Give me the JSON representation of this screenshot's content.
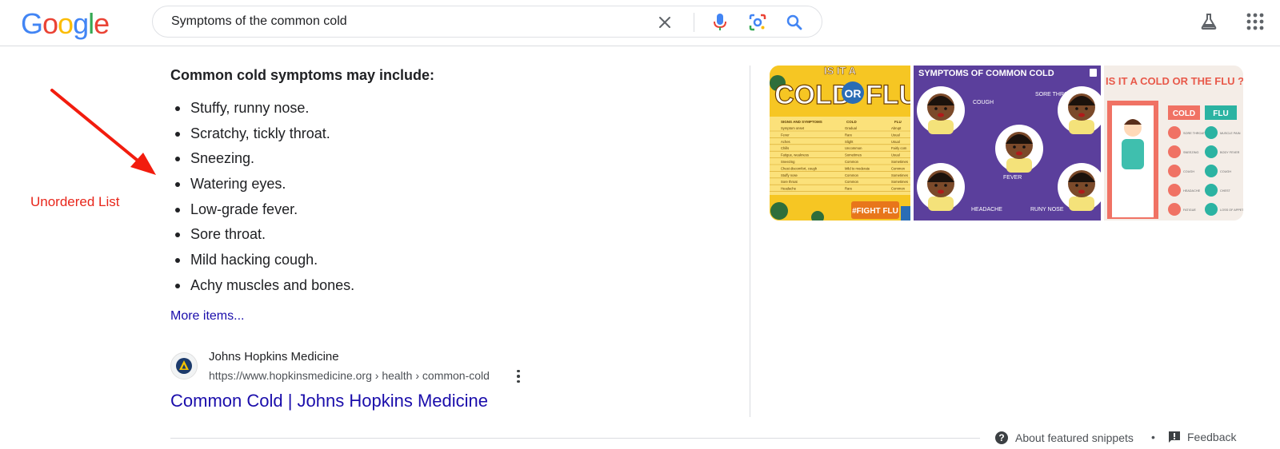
{
  "search": {
    "query": "Symptoms of the common cold"
  },
  "logo": {
    "letters": [
      "G",
      "o",
      "o",
      "g",
      "l",
      "e"
    ],
    "colors": [
      "#4285F4",
      "#EA4335",
      "#FBBC05",
      "#4285F4",
      "#34A853",
      "#EA4335"
    ]
  },
  "annotation": {
    "label": "Unordered List",
    "color": "#e8261b"
  },
  "snippet": {
    "heading": "Common cold symptoms may include:",
    "items": [
      "Stuffy, runny nose.",
      "Scratchy, tickly throat.",
      "Sneezing.",
      "Watering eyes.",
      "Low-grade fever.",
      "Sore throat.",
      "Mild hacking cough.",
      "Achy muscles and bones."
    ],
    "more_items": "More items..."
  },
  "source": {
    "name": "Johns Hopkins Medicine",
    "url": "https://www.hopkinsmedicine.org › health › common-cold",
    "title": "Common Cold | Johns Hopkins Medicine"
  },
  "images": {
    "img1": {
      "top_text": "IS IT A",
      "big_text_a": "COLD",
      "big_text_or": "OR",
      "big_text_b": "FLU",
      "col1": "SIGNS AND SYMPTOMS",
      "col2": "COLD",
      "col3": "FLU",
      "rows": [
        "Symptom onset",
        "Fever",
        "Aches",
        "Chills",
        "Fatigue, weakness",
        "Sneezing",
        "Chest discomfort, cough",
        "Stuffy nose",
        "Sore throat",
        "Headache"
      ],
      "cold_vals": [
        "Gradual",
        "Rare",
        "Slight",
        "Uncommon",
        "Sometimes",
        "Common",
        "Mild to moderate",
        "Common",
        "Common",
        "Rare"
      ],
      "flu_vals": [
        "Abrupt",
        "Usual",
        "Usual",
        "Fairly com",
        "Usual",
        "Sometimes",
        "Common",
        "Sometimes",
        "Sometimes",
        "Common"
      ],
      "tag": "#FIGHT FLU"
    },
    "img2": {
      "title": "SYMPTOMS OF COMMON COLD",
      "labels": [
        "COUGH",
        "SORE THROAT",
        "FEVER",
        "HEADACHE",
        "RUNY NOSE"
      ]
    },
    "img3": {
      "title": "IS IT A COLD OR THE FLU ?",
      "cold": "COLD",
      "flu": "FLU",
      "cold_items": [
        "SORE THROAT",
        "SNEEZING",
        "COUGH",
        "HEADACHE",
        "FATIGUE"
      ],
      "flu_items": [
        "MUSCLE PAIN",
        "BODY FEVER",
        "COUGH",
        "CHEST",
        "LOSS OF APPETITE"
      ]
    }
  },
  "footer": {
    "about": "About featured snippets",
    "separator": "•",
    "feedback": "Feedback"
  }
}
